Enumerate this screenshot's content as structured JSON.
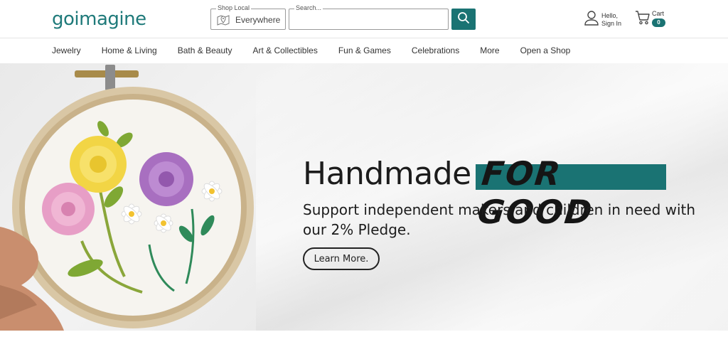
{
  "header": {
    "logo_text": "goimagine",
    "shop_local": {
      "legend": "Shop Local",
      "value": "Everywhere"
    },
    "search": {
      "legend": "Search...",
      "placeholder": ""
    },
    "account": {
      "line1": "Hello,",
      "line2": "Sign In"
    },
    "cart": {
      "label": "Cart",
      "count": "0"
    }
  },
  "nav": {
    "items": [
      "Jewelry",
      "Home & Living",
      "Bath & Beauty",
      "Art & Collectibles",
      "Fun & Games",
      "Celebrations",
      "More",
      "Open a Shop"
    ]
  },
  "hero": {
    "headline_main": "Handmade",
    "headline_accent": "FOR GOOD",
    "subtitle": "Support independent makers and children in need with our 2% Pledge.",
    "cta_label": "Learn More."
  },
  "colors": {
    "brand": "#1a7373",
    "text": "#1c1c1c"
  },
  "icons": {
    "shop_local": "map-pin-icon",
    "search": "search-icon",
    "account": "user-icon",
    "cart": "cart-icon"
  }
}
